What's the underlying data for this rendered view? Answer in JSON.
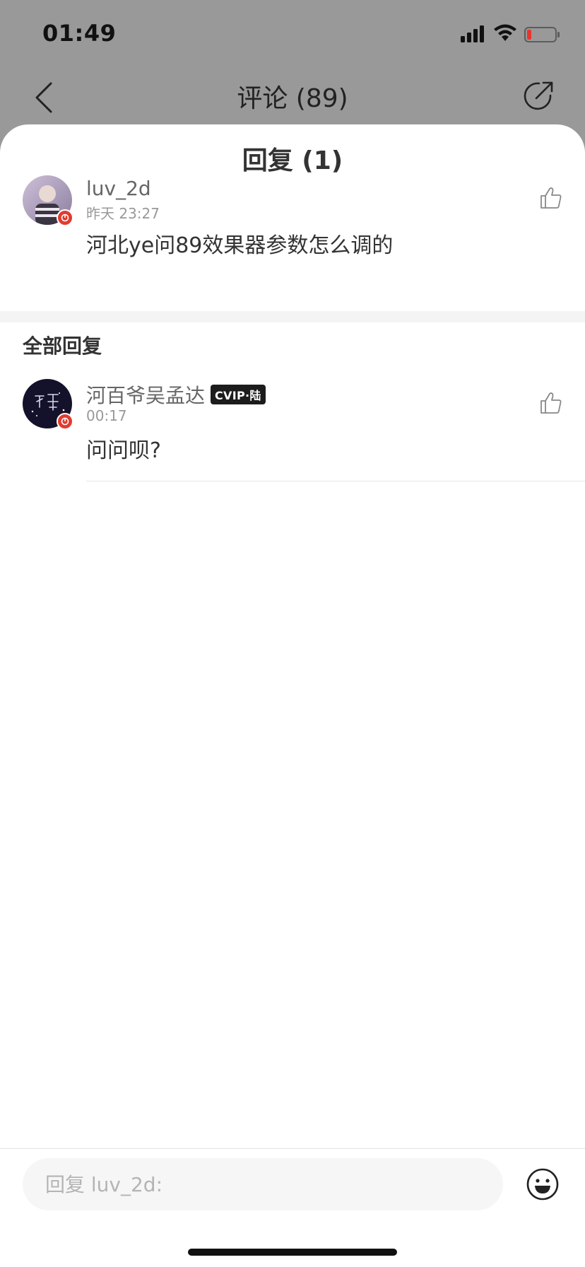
{
  "status_bar": {
    "time": "01:49",
    "icons": [
      "signal-icon",
      "wifi-icon",
      "battery-low-icon"
    ]
  },
  "nav": {
    "title": "评论 (89)",
    "back_icon": "chevron-left-icon",
    "share_icon": "share-icon"
  },
  "sheet": {
    "title": "回复 (1)"
  },
  "main_comment": {
    "username": "luv_2d",
    "timestamp": "昨天 23:27",
    "content": "河北ye问89效果器参数怎么调的",
    "like_icon": "thumbs-up-icon"
  },
  "replies_section": {
    "title": "全部回复",
    "items": [
      {
        "username": "河百爷吴孟达",
        "badge": "CVIP·陆",
        "timestamp": "00:17",
        "content": "问问呗?",
        "like_icon": "thumbs-up-icon"
      }
    ]
  },
  "bottom_bar": {
    "placeholder": "回复 luv_2d:",
    "emoji_icon": "emoji-icon"
  },
  "colors": {
    "overlay_bg": "#999999",
    "sheet_bg": "#ffffff",
    "badge_red": "#e03c2f",
    "vip_badge": "#1c1c1c"
  }
}
